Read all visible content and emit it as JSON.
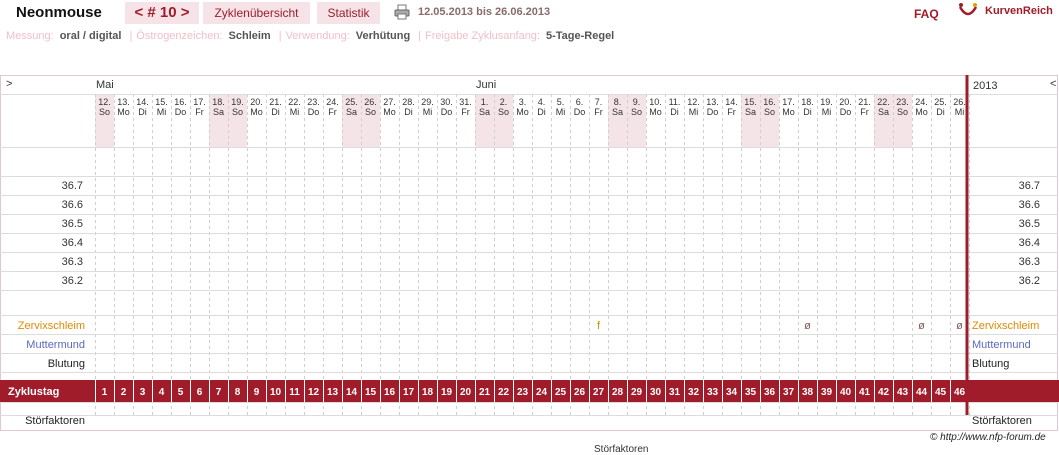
{
  "header": {
    "username": "Neonmouse",
    "cycle_nav": "< # 10 >",
    "tab_overview": "Zyklenübersicht",
    "tab_stats": "Statistik",
    "date_range": "12.05.2013 bis 26.06.2013",
    "faq": "FAQ",
    "logo": "KurvenReich"
  },
  "meta": {
    "measure_label": "Messung:",
    "measure_value": "oral / digital",
    "estrogen_label": "Östrogenzeichen:",
    "estrogen_value": "Schleim",
    "usage_label": "Verwendung:",
    "usage_value": "Verhütung",
    "release_label": "Freigabe Zyklusanfang:",
    "release_value": "5-Tage-Regel"
  },
  "chart": {
    "nav_left": ">",
    "nav_right": "<",
    "year": "2013",
    "month_labels": [
      {
        "day_index": 0,
        "label": "Mai"
      },
      {
        "day_index": 20,
        "label": "Juni"
      }
    ],
    "dates": [
      "12.",
      "13.",
      "14.",
      "15.",
      "16.",
      "17.",
      "18.",
      "19.",
      "20.",
      "21.",
      "22.",
      "23.",
      "24.",
      "25.",
      "26.",
      "27.",
      "28.",
      "29.",
      "30.",
      "31.",
      "1.",
      "2.",
      "3.",
      "4.",
      "5.",
      "6.",
      "7.",
      "8.",
      "9.",
      "10.",
      "11.",
      "12.",
      "13.",
      "14.",
      "15.",
      "16.",
      "17.",
      "18.",
      "19.",
      "20.",
      "21.",
      "22.",
      "23.",
      "24.",
      "25.",
      "26."
    ],
    "weekdays": [
      "So",
      "Mo",
      "Di",
      "Mi",
      "Do",
      "Fr",
      "Sa",
      "So",
      "Mo",
      "Di",
      "Mi",
      "Do",
      "Fr",
      "Sa",
      "So",
      "Mo",
      "Di",
      "Mi",
      "Do",
      "Fr",
      "Sa",
      "So",
      "Mo",
      "Di",
      "Mi",
      "Do",
      "Fr",
      "Sa",
      "So",
      "Mo",
      "Di",
      "Mi",
      "Do",
      "Fr",
      "Sa",
      "So",
      "Mo",
      "Di",
      "Mi",
      "Do",
      "Fr",
      "Sa",
      "So",
      "Mo",
      "Di",
      "Mi"
    ],
    "temp_ticks": [
      "36.7",
      "36.6",
      "36.5",
      "36.4",
      "36.3",
      "36.2"
    ],
    "rows": {
      "cervical": "Zervixschleim",
      "cervix": "Muttermund",
      "bleeding": "Blutung",
      "cycle_day": "Zyklustag",
      "disturbances": "Störfaktoren"
    },
    "cervical_marks": [
      {
        "day": 27,
        "symbol": "f"
      },
      {
        "day": 38,
        "symbol": "ø"
      },
      {
        "day": 44,
        "symbol": "ø"
      },
      {
        "day": 46,
        "symbol": "ø"
      }
    ],
    "colors": {
      "accent": "#a01c2a",
      "weekend": "#f5e4e7",
      "cervical_label": "#e08a00",
      "cervix_label": "#5a6ac0",
      "grid": "#dddddd"
    }
  },
  "footer": {
    "copyright": "© http://www.nfp-forum.de",
    "cut_text": "Störfaktoren"
  }
}
